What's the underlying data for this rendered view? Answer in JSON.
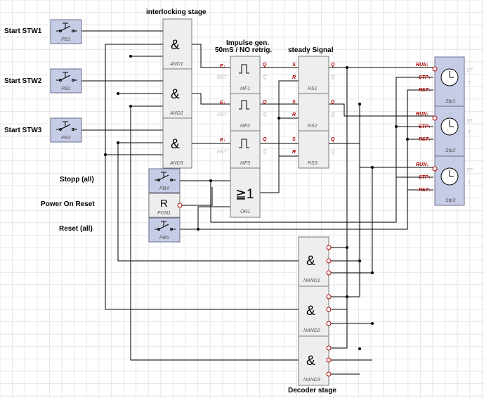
{
  "labels": {
    "interlocking": "interlocking stage",
    "impulse_line1": "Impulse gen.",
    "impulse_line2": "50mS / NO retrig.",
    "steady": "steady Signal",
    "decoder": "Decoder stage",
    "start1": "Start STW1",
    "start2": "Start STW2",
    "start3": "Start STW3",
    "stopp": "Stopp (all)",
    "por": "Power On Reset",
    "reset": "Reset (all)"
  },
  "symbols": {
    "and": "&",
    "or": "≧1",
    "r": "R"
  },
  "buttons": {
    "pb1": "PB1",
    "pb2": "PB2",
    "pb3": "PB3",
    "pb4": "PB4",
    "pb5": "PB5",
    "pon1": "PON1"
  },
  "and_gates": [
    "AND1",
    "AND2",
    "AND3"
  ],
  "mf_blocks": [
    "MF1",
    "MF2",
    "MF3"
  ],
  "rs_blocks": [
    "RS1",
    "RS2",
    "RS3"
  ],
  "or_block": "OR1",
  "timers": [
    "Stp1",
    "Stp2",
    "Stp3"
  ],
  "nand_gates": [
    "NAND1",
    "NAND2",
    "NAND3"
  ],
  "pins": {
    "e": "E↓",
    "rst": "RST",
    "q": "Q",
    "qbar": "Q̄",
    "s": "S",
    "r": "R",
    "run": "RUN↓",
    "stp": "STP↓",
    "rst_timer": "RST↓",
    "st": "ST",
    "t": "T"
  },
  "colors": {
    "button_fill": "#c7cce6",
    "block_fill": "#eeeeee",
    "pin_red": "#b00000"
  }
}
